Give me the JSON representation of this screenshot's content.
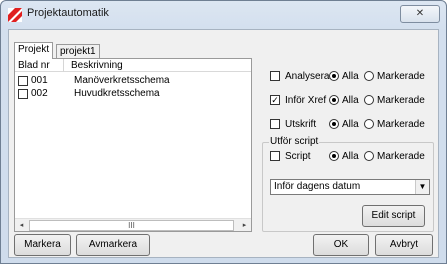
{
  "window": {
    "title": "Projektautomatik",
    "close_glyph": "✕",
    "icon": "app-icon"
  },
  "tabs": [
    {
      "label": "Projekt"
    },
    {
      "label": "projekt1"
    }
  ],
  "list": {
    "columns": [
      "Blad nr",
      "Beskrivning"
    ],
    "rows": [
      {
        "checked": false,
        "number": "001",
        "description": "Manöverkretsschema"
      },
      {
        "checked": false,
        "number": "002",
        "description": "Huvudkretsschema"
      }
    ],
    "scroll_left": "◂",
    "scroll_right": "▸",
    "scroll_grip": "III"
  },
  "options": [
    {
      "label": "Analysera",
      "checked": false,
      "all_label": "Alla",
      "marked_label": "Markerade",
      "selected": "Alla"
    },
    {
      "label": "Inför Xref",
      "checked": true,
      "all_label": "Alla",
      "marked_label": "Markerade",
      "selected": "Alla"
    },
    {
      "label": "Utskrift",
      "checked": false,
      "all_label": "Alla",
      "marked_label": "Markerade",
      "selected": "Alla"
    }
  ],
  "script_group": {
    "title": "Utför script",
    "script_label": "Script",
    "script_checked": false,
    "all_label": "Alla",
    "marked_label": "Markerade",
    "selected": "Alla",
    "dropdown_value": "Inför dagens datum",
    "edit_button": "Edit script"
  },
  "buttons": {
    "mark": "Markera",
    "unmark": "Avmarkera",
    "ok": "OK",
    "cancel": "Avbryt"
  },
  "colors": {
    "accent": "#e02020",
    "window_frame": "#dce6f2"
  }
}
